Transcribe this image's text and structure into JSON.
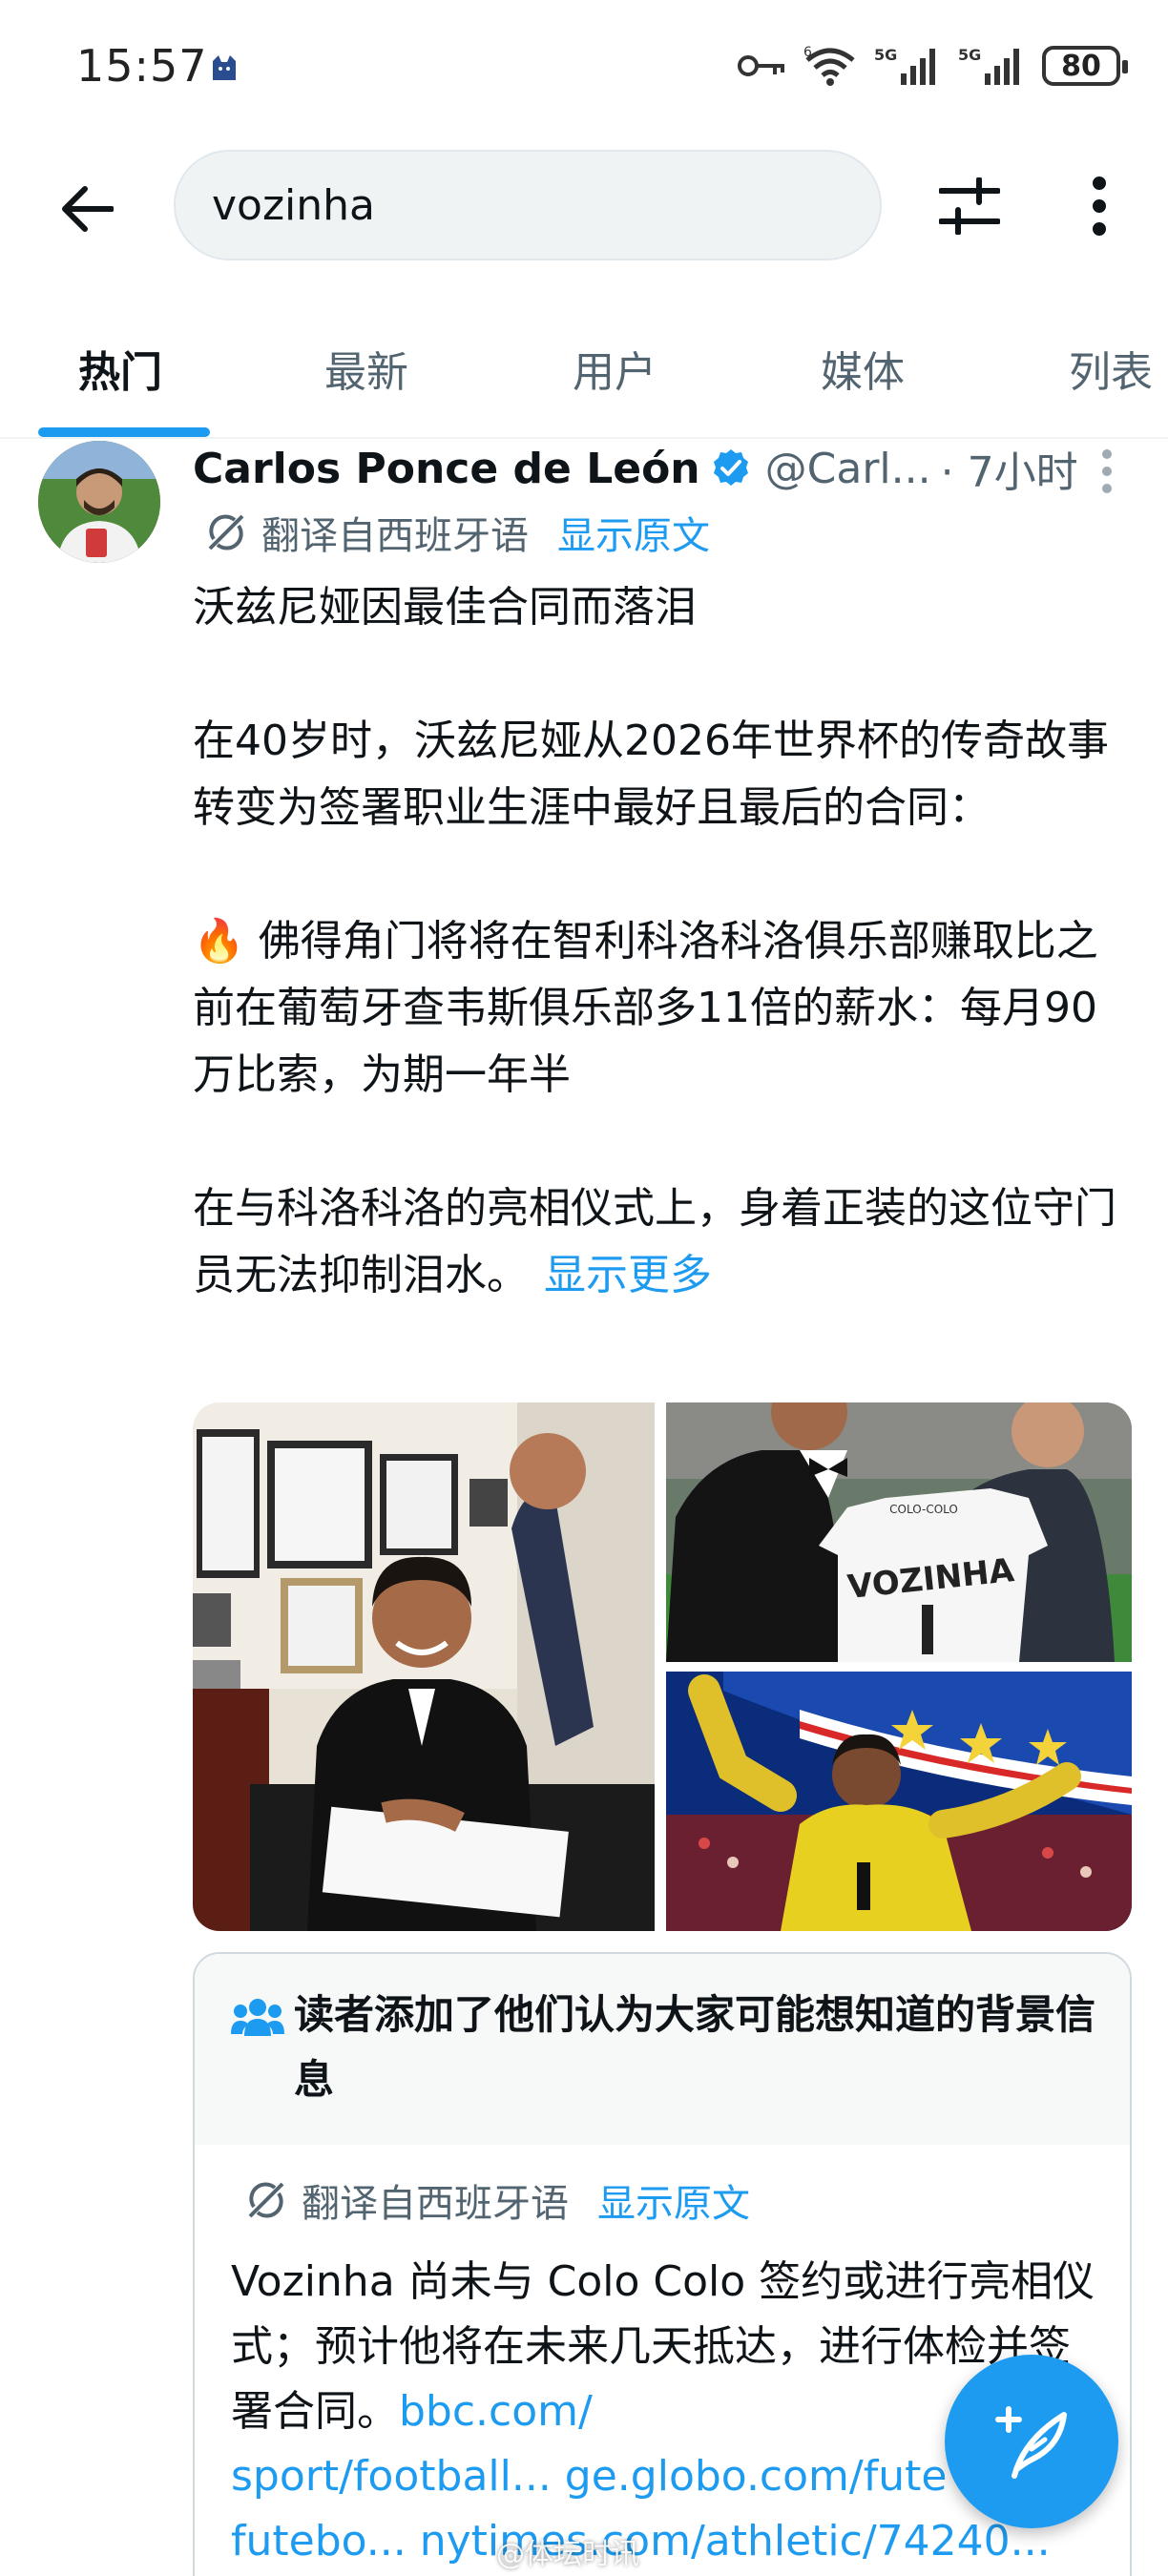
{
  "status_bar": {
    "time": "15:57",
    "network_5g_1": "5G",
    "network_5g_2": "5G",
    "wifi_label": "6",
    "battery": "80"
  },
  "search": {
    "query": "vozinha"
  },
  "tabs": [
    {
      "label": "热门",
      "active": true
    },
    {
      "label": "最新",
      "active": false
    },
    {
      "label": "用户",
      "active": false
    },
    {
      "label": "媒体",
      "active": false
    },
    {
      "label": "列表",
      "active": false
    }
  ],
  "tweet": {
    "author_name": "Carlos Ponce de León",
    "handle": "@Carl...",
    "time": "· 7小时",
    "translate_label": "翻译自西班牙语",
    "show_original": "显示原文",
    "paragraphs": [
      "沃兹尼娅因最佳合同而落泪",
      "在40岁时，沃兹尼娅从2026年世界杯的传奇故事转变为签署职业生涯中最好且最后的合同：",
      "🔥 佛得角门将将在智利科洛科洛俱乐部赚取比之前在葡萄牙查韦斯俱乐部多11倍的薪水：每月90万比索，为期一年半",
      "在与科洛科洛的亮相仪式上，身着正装的这位守门员无法抑制泪水。"
    ],
    "show_more": "显示更多",
    "media": {
      "image_1_jersey_text": "VOZINHA",
      "image_1_jersey_small": "COLO-COLO"
    }
  },
  "note": {
    "title": "读者添加了他们认为大家可能想知道的背景信息",
    "translate_label": "翻译自西班牙语",
    "show_original": "显示原文",
    "body_text": "Vozinha 尚未与 Colo Colo 签约或进行亮相仪式；预计他将在未来几天抵达，进行体检并签署合同。",
    "link_1": "bbc.com/",
    "link_2": "sport/football... ge.globo.com/fute",
    "link_3": "futebo... nytimes.com/athletic/74240..."
  },
  "watermark": "@体坛时讯",
  "colors": {
    "accent": "#1d9bf0",
    "text_primary": "#0f1419",
    "text_secondary": "#536471"
  }
}
